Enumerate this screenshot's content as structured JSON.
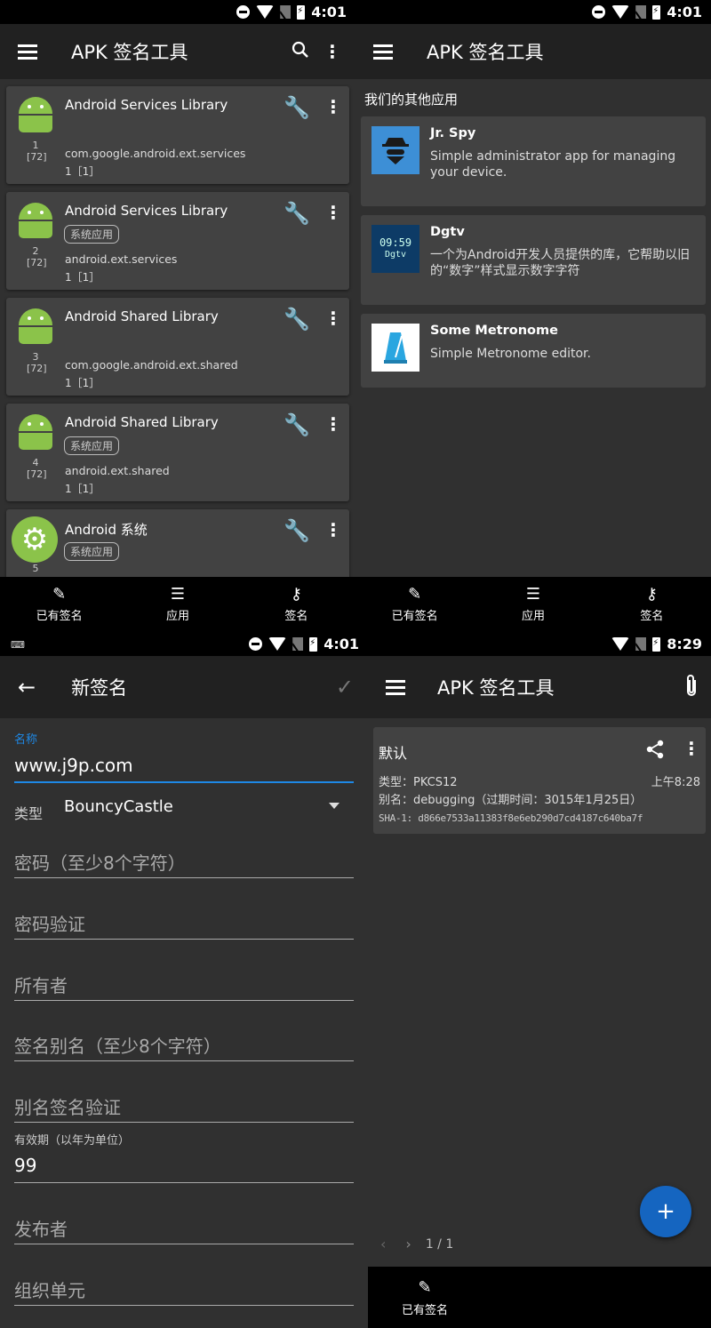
{
  "status": {
    "time_a": "4:01",
    "time_b": "4:01",
    "time_c": "4:01",
    "time_d": "8:29",
    "keyboard_icon": "keyboard-icon"
  },
  "app": {
    "title": "APK 签名工具"
  },
  "colors": {
    "android_green": "#8bc34a",
    "fab_blue": "#1565c0",
    "card": "#424242",
    "appbar": "#212121"
  },
  "apps": [
    {
      "name": "Android Services Library",
      "tag": "",
      "num": "1",
      "api": "[72]",
      "package": "com.google.android.ext.services",
      "version": "1［1］"
    },
    {
      "name": "Android Services Library",
      "tag": "系统应用",
      "num": "2",
      "api": "[72]",
      "package": "android.ext.services",
      "version": "1［1］"
    },
    {
      "name": "Android Shared Library",
      "tag": "",
      "num": "3",
      "api": "[72]",
      "package": "com.google.android.ext.shared",
      "version": "1［1］"
    },
    {
      "name": "Android Shared Library",
      "tag": "系统应用",
      "num": "4",
      "api": "[72]",
      "package": "android.ext.shared",
      "version": "1［1］"
    },
    {
      "name": "Android 系统",
      "tag": "系统应用",
      "num": "5",
      "api": "",
      "package": "",
      "version": ""
    }
  ],
  "nav": {
    "signatures": "已有签名",
    "apps": "应用",
    "sign": "签名"
  },
  "other_apps": {
    "section_title": "我们的其他应用",
    "items": [
      {
        "name": "Jr. Spy",
        "desc": "Simple administrator app for managing your device.",
        "icon": "spy-icon"
      },
      {
        "name": "Dgtv",
        "desc": "一个为Android开发人员提供的库，它帮助以旧的“数字”样式显示数字字符",
        "icon": "digital-clock-icon",
        "icon_text_1": "09:59",
        "icon_text_2": "Dgtv"
      },
      {
        "name": "Some Metronome",
        "desc": "Simple Metronome editor.",
        "icon": "metronome-icon"
      }
    ]
  },
  "new_signature": {
    "title": "新签名",
    "name_label": "名称",
    "name_value": "www.j9p.com",
    "type_label": "类型",
    "type_value": "BouncyCastle",
    "password_ph": "密码（至少8个字符）",
    "password_confirm_ph": "密码验证",
    "owner_ph": "所有者",
    "alias_ph": "签名别名（至少8个字符）",
    "alias_confirm_ph": "别名签名验证",
    "validity_label": "有效期（以年为单位）",
    "validity_value": "99",
    "issuer_ph": "发布者",
    "org_unit_ph": "组织单元"
  },
  "signatures": {
    "card_title": "默认",
    "type_line": "类型：PKCS12",
    "time": "上午8:28",
    "alias_line": "别名：debugging（过期时间：3015年1月25日）",
    "sha_line": "SHA-1: d866e7533a11383f8e6eb290d7cd4187c640ba7f",
    "pagination": "1 / 1",
    "fab": "+"
  }
}
